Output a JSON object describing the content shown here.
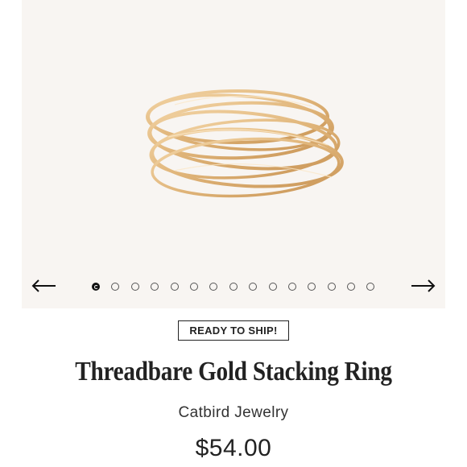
{
  "gallery": {
    "image_alt": "gold-stacking-rings-photo",
    "slide_count": 15,
    "active_index": 0,
    "prev_icon": "arrow-left-icon",
    "next_icon": "arrow-right-icon"
  },
  "badge": {
    "label": "READY TO SHIP!"
  },
  "product": {
    "title": "Threadbare Gold Stacking Ring",
    "brand": "Catbird Jewelry",
    "price": "$54.00"
  },
  "colors": {
    "gallery_background": "#f8f5f2",
    "gold": "#e2b77f",
    "text": "#222222"
  }
}
